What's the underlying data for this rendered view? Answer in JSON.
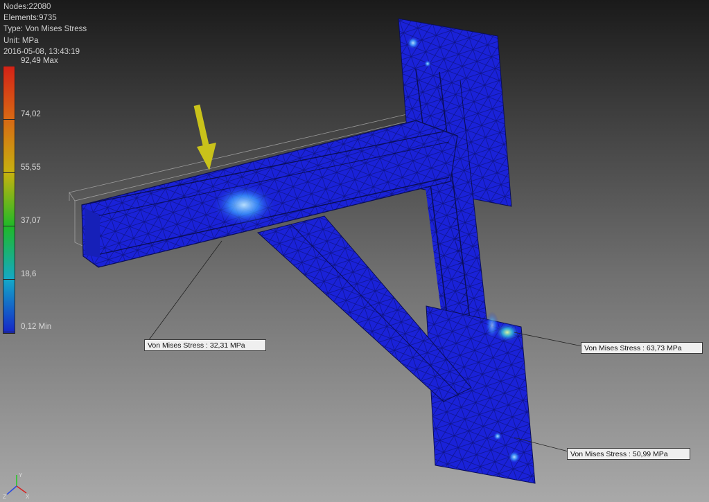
{
  "info": {
    "nodes": "Nodes:22080",
    "elements": "Elements:9735",
    "type": "Type: Von Mises Stress",
    "unit": "Unit: MPa",
    "timestamp": "2016-05-08, 13:43:19"
  },
  "legend": {
    "labels": [
      "92,49 Max",
      "74,02",
      "55,55",
      "37,07",
      "18,6",
      "0,12 Min"
    ],
    "colors": [
      "#d42216",
      "#d86a14",
      "#c6b20f",
      "#1fb828",
      "#14a8c8",
      "#1525c8"
    ]
  },
  "callouts": {
    "beam": "Von Mises Stress : 32,31 MPa",
    "upper_right": "Von Mises Stress : 63,73 MPa",
    "lower_right": "Von Mises Stress : 50,99 MPa"
  },
  "load_arrow": {
    "color": "#c9c21a"
  },
  "model": {
    "mesh_color": "#1a22d8"
  },
  "triad": {
    "x": "X",
    "y": "Y",
    "z": "Z"
  }
}
